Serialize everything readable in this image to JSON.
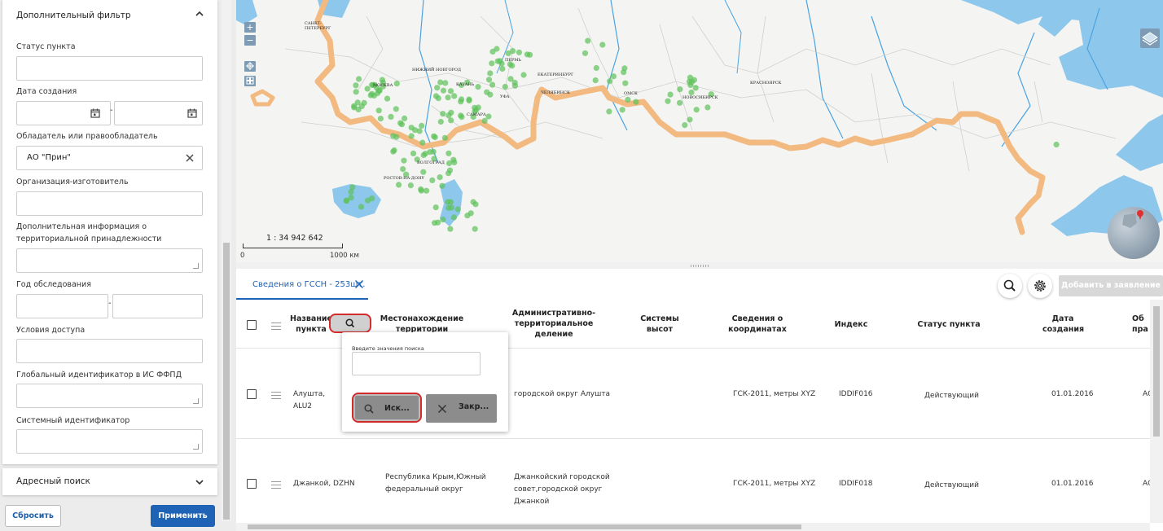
{
  "filter": {
    "title": "Дополнительный фильтр",
    "fields": {
      "status": "Статус пункта",
      "created": "Дата создания",
      "owner": "Обладатель или правообладатель",
      "owner_value": "АО \"Прин\"",
      "manufacturer": "Организация-изготовитель",
      "extra_info": "Дополнительная информация о территориальной принадлежности",
      "survey_year": "Год обследования",
      "access": "Условия доступа",
      "global_id": "Глобальный идентификатор в ИС ФФПД",
      "system_id": "Системный идентификатор"
    },
    "date_sep": "-",
    "year_sep": "-"
  },
  "address": {
    "title": "Адресный поиск"
  },
  "actions": {
    "reset": "Сбросить",
    "apply": "Применить"
  },
  "map": {
    "scale_text": "1 : 34 942 642",
    "scale_start": "0",
    "scale_end": "1000 км",
    "zoom_in": "+",
    "zoom_out": "−",
    "cities": {
      "spb": "САНКТ-ПЕТЕРБУРГ",
      "moscow": "МОСКВА",
      "nnovgorod": "НИЖНИЙ НОВГОРОД",
      "kazan": "КАЗАНЬ",
      "perm": "ПЕРМЬ",
      "ekb": "ЕКАТЕРИНБУРГ",
      "ufa": "УФА",
      "chelyabinsk": "ЧЕЛЯБИНСК",
      "samara": "САМАРА",
      "omsk": "ОМСК",
      "novosibirsk": "НОВОСИБИРСК",
      "krasnoyarsk": "КРАСНОЯРСК",
      "volgograd": "ВОЛГОГРАД",
      "rostov": "РОСТОВ-НА-ДОНУ"
    }
  },
  "results": {
    "tab_label": "Сведения о ГССН - 253шт.",
    "add_button": "Добавить в заявление",
    "columns": {
      "name": "Название пункта",
      "location": "Местонахождение территории",
      "admin": "Административно-территориальное деление",
      "heights": "Системы высот",
      "coords": "Сведения о координатах",
      "index": "Индекс",
      "status": "Статус пункта",
      "created": "Дата создания",
      "owner": "Об пра"
    },
    "rows": [
      {
        "name": "Алушта, ALU2",
        "location": "",
        "admin": "городской округ Алушта",
        "coords": "ГСК-2011, метры XYZ",
        "index": "IDDIF016",
        "status": "Действующий",
        "created": "01.01.2016",
        "owner": "АО"
      },
      {
        "name": "Джанкой, DZHN",
        "location": "Республика Крым,Южный федеральный округ",
        "admin": "Джанкойский городской совет,городской округ Джанкой",
        "coords": "ГСК-2011, метры XYZ",
        "index": "IDDIF018",
        "status": "Действующий",
        "created": "01.01.2016",
        "owner": "АО"
      }
    ],
    "search_popup": {
      "label": "Введите значения поиска",
      "search_button": "Иск...",
      "close_button": "Закр..."
    }
  },
  "colors": {
    "accent": "#1e63b6",
    "highlight": "#d42b2b",
    "marker": "#5cc25a",
    "border": "#f2b980",
    "water": "#8ec7ec"
  }
}
